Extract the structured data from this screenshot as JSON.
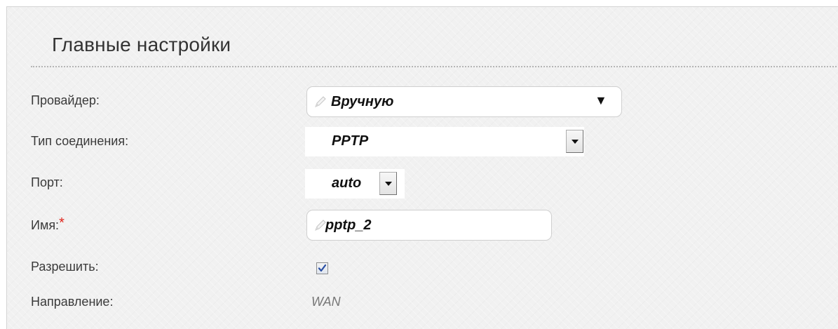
{
  "section": {
    "title": "Главные настройки"
  },
  "form": {
    "provider": {
      "label": "Провайдер:",
      "value": "Вручную",
      "icon": "pencil-icon"
    },
    "connection_type": {
      "label": "Тип соединения:",
      "value": "PPTP"
    },
    "port": {
      "label": "Порт:",
      "value": "auto"
    },
    "name": {
      "label": "Имя:",
      "required_mark": "*",
      "value": "pptp_2",
      "icon": "pencil-icon"
    },
    "enable": {
      "label": "Разрешить:",
      "checked": true
    },
    "direction": {
      "label": "Направление:",
      "value": "WAN"
    }
  },
  "colors": {
    "panel_background": "#f1f1f1",
    "required_mark": "#e0261d",
    "checkmark": "#2a4fa3",
    "muted_value": "#777777"
  }
}
